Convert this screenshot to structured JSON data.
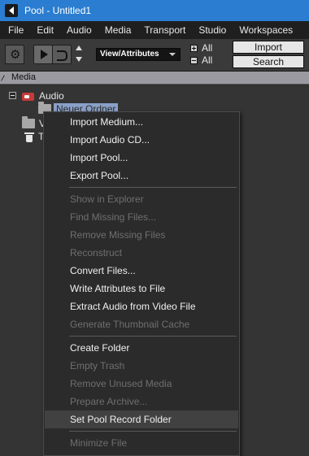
{
  "window": {
    "title": "Pool - Untitled1"
  },
  "menubar": [
    "File",
    "Edit",
    "Audio",
    "Media",
    "Transport",
    "Studio",
    "Workspaces"
  ],
  "toolbar": {
    "view_select": "View/Attributes",
    "expand_all": "All",
    "collapse_all": "All",
    "import_label": "Import",
    "search_label": "Search"
  },
  "columns": {
    "media": "Media"
  },
  "tree": {
    "audio": "Audio",
    "folder": "Neuer Ordner",
    "video_partial": "V",
    "trash_partial": "T"
  },
  "context_menu": {
    "items": [
      {
        "label": "Import Medium...",
        "enabled": true
      },
      {
        "label": "Import Audio CD...",
        "enabled": true
      },
      {
        "label": "Import Pool...",
        "enabled": true
      },
      {
        "label": "Export Pool...",
        "enabled": true
      },
      {
        "label": "Show in Explorer",
        "enabled": false
      },
      {
        "label": "Find Missing Files...",
        "enabled": false
      },
      {
        "label": "Remove Missing Files",
        "enabled": false
      },
      {
        "label": "Reconstruct",
        "enabled": false
      },
      {
        "label": "Convert Files...",
        "enabled": true
      },
      {
        "label": "Write Attributes to File",
        "enabled": true
      },
      {
        "label": "Extract Audio from Video File",
        "enabled": true
      },
      {
        "label": "Generate Thumbnail Cache",
        "enabled": false
      },
      {
        "label": "Create Folder",
        "enabled": true
      },
      {
        "label": "Empty Trash",
        "enabled": false
      },
      {
        "label": "Remove Unused Media",
        "enabled": false
      },
      {
        "label": "Prepare Archive...",
        "enabled": false
      },
      {
        "label": "Set Pool Record Folder",
        "enabled": true,
        "highlighted": true
      },
      {
        "label": "Minimize File",
        "enabled": false
      }
    ]
  },
  "colors": {
    "titlebar": "#2a7dd0",
    "menu_background": "#2b2b2b",
    "disabled_text": "#6f6f6f",
    "selection": "#8aa0c8"
  }
}
